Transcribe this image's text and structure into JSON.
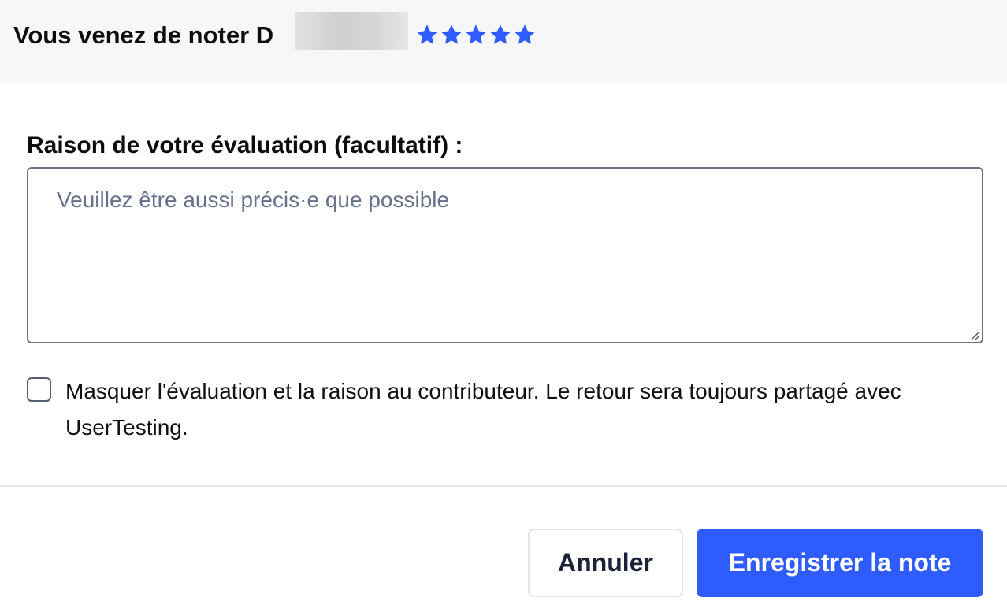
{
  "header": {
    "title": "Vous venez de noter D",
    "rating": 5,
    "max_rating": 5,
    "star_color": "#2f5cff"
  },
  "form": {
    "reason_label": "Raison de votre évaluation (facultatif) :",
    "reason_placeholder": "Veuillez être aussi précis·e que possible",
    "reason_value": "",
    "hide_checkbox_checked": false,
    "hide_checkbox_label": "Masquer l'évaluation et la raison au contributeur. Le retour sera toujours partagé avec UserTesting."
  },
  "actions": {
    "cancel_label": "Annuler",
    "save_label": "Enregistrer la note",
    "primary_color": "#2f5cff"
  }
}
